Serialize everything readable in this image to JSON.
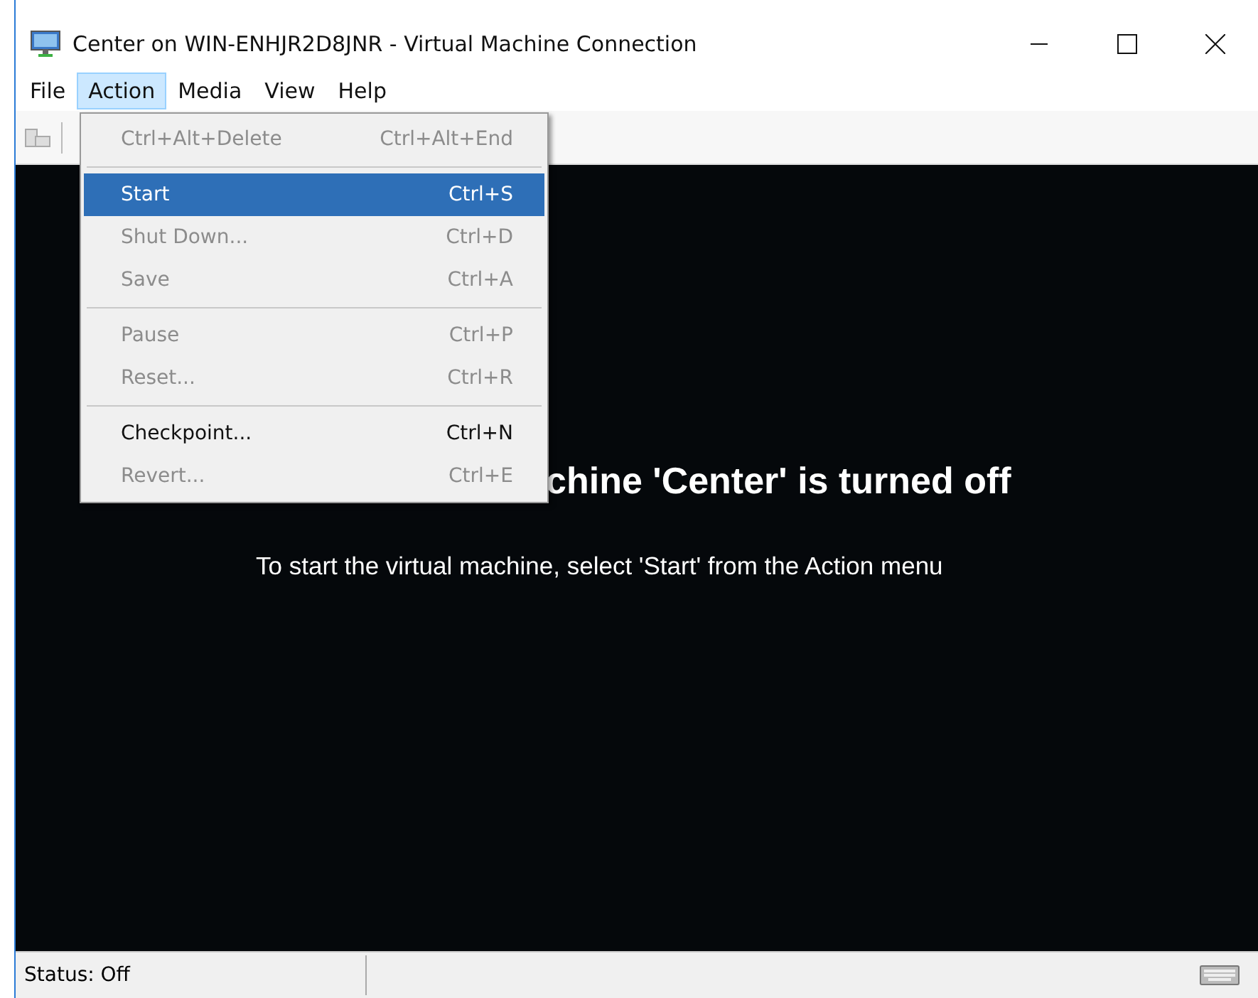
{
  "window": {
    "title": "Center on WIN-ENHJR2D8JNR - Virtual Machine Connection"
  },
  "menubar": [
    {
      "label": "File",
      "selected": false
    },
    {
      "label": "Action",
      "selected": true
    },
    {
      "label": "Media",
      "selected": false
    },
    {
      "label": "View",
      "selected": false
    },
    {
      "label": "Help",
      "selected": false
    }
  ],
  "action_menu": [
    {
      "kind": "item",
      "label": "Ctrl+Alt+Delete",
      "shortcut": "Ctrl+Alt+End",
      "disabled": true,
      "selected": false
    },
    {
      "kind": "separator"
    },
    {
      "kind": "item",
      "label": "Start",
      "shortcut": "Ctrl+S",
      "disabled": false,
      "selected": true
    },
    {
      "kind": "item",
      "label": "Shut Down...",
      "shortcut": "Ctrl+D",
      "disabled": true,
      "selected": false
    },
    {
      "kind": "item",
      "label": "Save",
      "shortcut": "Ctrl+A",
      "disabled": true,
      "selected": false
    },
    {
      "kind": "separator"
    },
    {
      "kind": "item",
      "label": "Pause",
      "shortcut": "Ctrl+P",
      "disabled": true,
      "selected": false
    },
    {
      "kind": "item",
      "label": "Reset...",
      "shortcut": "Ctrl+R",
      "disabled": true,
      "selected": false
    },
    {
      "kind": "separator"
    },
    {
      "kind": "item",
      "label": "Checkpoint...",
      "shortcut": "Ctrl+N",
      "disabled": false,
      "selected": false
    },
    {
      "kind": "item",
      "label": "Revert...",
      "shortcut": "Ctrl+E",
      "disabled": true,
      "selected": false
    }
  ],
  "screen": {
    "heading": "chine 'Center' is turned off",
    "message": "To start the virtual machine, select 'Start' from the Action menu"
  },
  "status_bar": {
    "status": "Status: Off"
  }
}
